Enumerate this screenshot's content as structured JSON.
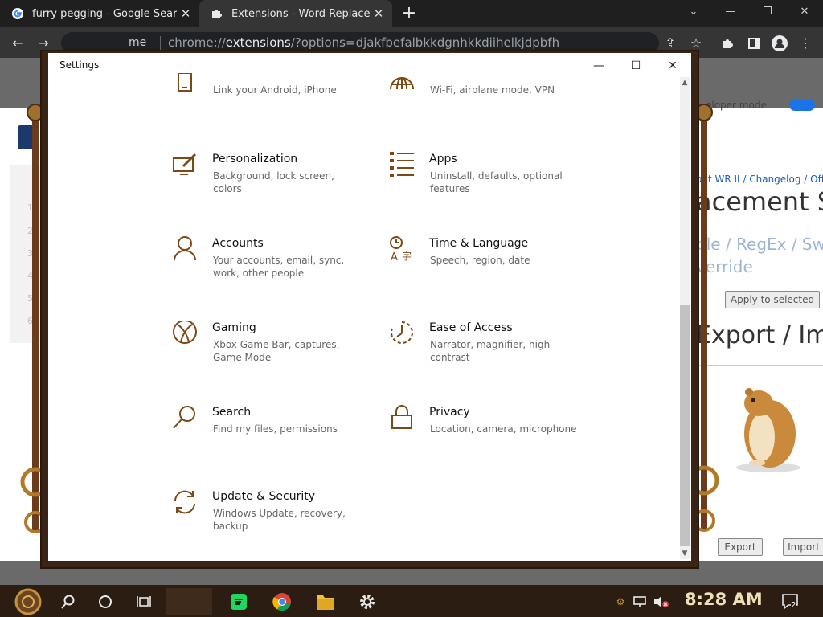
{
  "browser": {
    "tabs": [
      {
        "title": "furry pegging - Google Search",
        "active": false,
        "icon": "google-icon"
      },
      {
        "title": "Extensions - Word Replacer II",
        "active": true,
        "icon": "puzzle-icon"
      }
    ],
    "address_host": "me",
    "address_url_prefix": "chrome://",
    "address_url_bold": "extensions",
    "address_url_suffix": "/?options=djakfbefalbkkdgnhkkdiihelkjdpbfh",
    "window_controls": {
      "minimize": "—",
      "maximize": "❐",
      "close": "✕"
    }
  },
  "extension_page": {
    "developer_mode_label": "eloper mode",
    "row_numbers": [
      "1",
      "2",
      "3",
      "4",
      "5",
      "6"
    ],
    "breadcrumb": "out WR II / Changelog / Offici",
    "heading": "acement Se",
    "subnav": "ple / RegEx / Swap",
    "subnav2": "verride",
    "apply_button": "Apply to selected",
    "export_heading": "Export / Imp",
    "export_button": "Export",
    "import_button": "Import"
  },
  "settings_window": {
    "title": "Settings",
    "controls": {
      "minimize": "—",
      "maximize": "☐",
      "close": "✕"
    },
    "accent_color": "#7a4a14",
    "items": [
      {
        "title": "",
        "desc": "Link your Android, iPhone",
        "icon": "phone-icon"
      },
      {
        "title": "",
        "desc": "Wi-Fi, airplane mode, VPN",
        "icon": "globe-icon"
      },
      {
        "title": "Personalization",
        "desc": "Background, lock screen, colors",
        "icon": "personalization-icon"
      },
      {
        "title": "Apps",
        "desc": "Uninstall, defaults, optional features",
        "icon": "apps-icon"
      },
      {
        "title": "Accounts",
        "desc": "Your accounts, email, sync, work, other people",
        "icon": "person-icon"
      },
      {
        "title": "Time & Language",
        "desc": "Speech, region, date",
        "icon": "time-language-icon"
      },
      {
        "title": "Gaming",
        "desc": "Xbox Game Bar, captures, Game Mode",
        "icon": "xbox-icon"
      },
      {
        "title": "Ease of Access",
        "desc": "Narrator, magnifier, high contrast",
        "icon": "ease-of-access-icon"
      },
      {
        "title": "Search",
        "desc": "Find my files, permissions",
        "icon": "search-icon"
      },
      {
        "title": "Privacy",
        "desc": "Location, camera, microphone",
        "icon": "lock-icon"
      },
      {
        "title": "Update & Security",
        "desc": "Windows Update, recovery, backup",
        "icon": "update-icon"
      }
    ]
  },
  "taskbar": {
    "clock": "8:28 AM",
    "notification_count": "2",
    "pinned": [
      "cortana-icon",
      "task-view-icon",
      "spotify-icon",
      "chrome-icon",
      "file-explorer-icon",
      "settings-gear-icon"
    ]
  }
}
